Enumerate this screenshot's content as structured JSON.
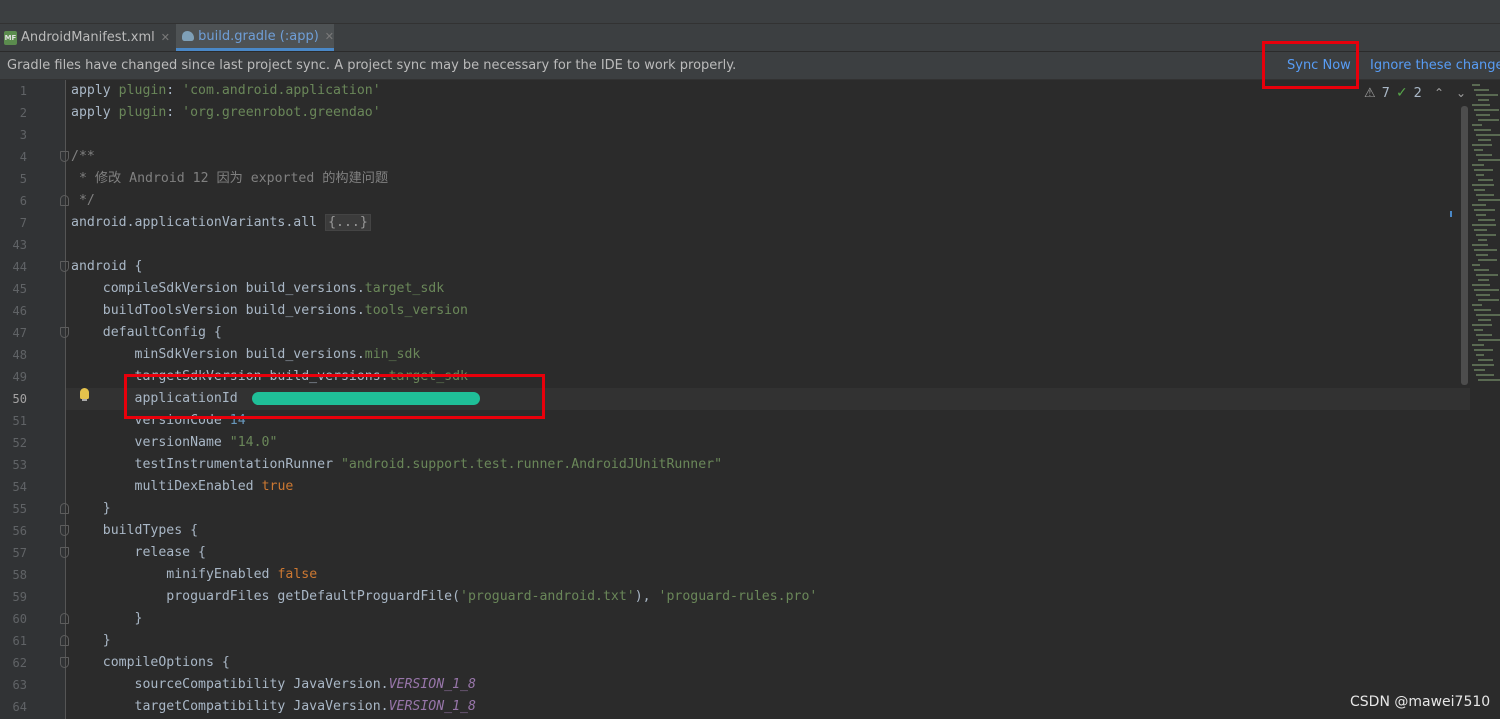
{
  "tabs": [
    {
      "label": "AndroidManifest.xml",
      "icon": "xml-file-icon",
      "active": false
    },
    {
      "label": "build.gradle (:app)",
      "icon": "gradle-file-icon",
      "active": true
    }
  ],
  "notification": {
    "message": "Gradle files have changed since last project sync. A project sync may be necessary for the IDE to work properly.",
    "sync_label": "Sync Now",
    "ignore_label": "Ignore these changes"
  },
  "inspections": {
    "warnings": "7",
    "ok": "2"
  },
  "editor": {
    "current_line": "50",
    "lines": [
      {
        "num": "1",
        "tokens": [
          [
            "plain",
            "apply "
          ],
          [
            "prop",
            "plugin"
          ],
          [
            "plain",
            ": "
          ],
          [
            "str",
            "'com.android.application'"
          ]
        ]
      },
      {
        "num": "2",
        "tokens": [
          [
            "plain",
            "apply "
          ],
          [
            "prop",
            "plugin"
          ],
          [
            "plain",
            ": "
          ],
          [
            "str",
            "'org.greenrobot.greendao'"
          ]
        ]
      },
      {
        "num": "3",
        "tokens": []
      },
      {
        "num": "4",
        "tokens": [
          [
            "comment",
            "/**"
          ]
        ]
      },
      {
        "num": "5",
        "tokens": [
          [
            "comment",
            " * 修改 Android 12 因为 exported 的构建问题"
          ]
        ]
      },
      {
        "num": "6",
        "tokens": [
          [
            "comment",
            " */"
          ]
        ]
      },
      {
        "num": "7",
        "tokens": [
          [
            "plain",
            "android.applicationVariants.all "
          ],
          [
            "folded",
            "{...}"
          ]
        ]
      },
      {
        "num": "43",
        "tokens": []
      },
      {
        "num": "44",
        "tokens": [
          [
            "plain",
            "android {"
          ]
        ]
      },
      {
        "num": "45",
        "tokens": [
          [
            "plain",
            "    compileSdkVersion build_versions."
          ],
          [
            "prop",
            "target_sdk"
          ]
        ]
      },
      {
        "num": "46",
        "tokens": [
          [
            "plain",
            "    buildToolsVersion build_versions."
          ],
          [
            "prop",
            "tools_version"
          ]
        ]
      },
      {
        "num": "47",
        "tokens": [
          [
            "plain",
            "    defaultConfig {"
          ]
        ]
      },
      {
        "num": "48",
        "tokens": [
          [
            "plain",
            "        minSdkVersion build_versions."
          ],
          [
            "prop",
            "min_sdk"
          ]
        ]
      },
      {
        "num": "49",
        "tokens": [
          [
            "plain",
            "        targetSdkVersion build_versions."
          ],
          [
            "prop",
            "target_sdk"
          ]
        ]
      },
      {
        "num": "50",
        "tokens": [
          [
            "plain",
            "        applicationId "
          ],
          [
            "redacted",
            ""
          ]
        ]
      },
      {
        "num": "51",
        "tokens": [
          [
            "plain",
            "        versionCode "
          ],
          [
            "num",
            "14"
          ]
        ]
      },
      {
        "num": "52",
        "tokens": [
          [
            "plain",
            "        versionName "
          ],
          [
            "str",
            "\"14.0\""
          ]
        ]
      },
      {
        "num": "53",
        "tokens": [
          [
            "plain",
            "        testInstrumentationRunner "
          ],
          [
            "str",
            "\"android.support.test.runner.AndroidJUnitRunner\""
          ]
        ]
      },
      {
        "num": "54",
        "tokens": [
          [
            "plain",
            "        multiDexEnabled "
          ],
          [
            "kw",
            "true"
          ]
        ]
      },
      {
        "num": "55",
        "tokens": [
          [
            "plain",
            "    }"
          ]
        ]
      },
      {
        "num": "56",
        "tokens": [
          [
            "plain",
            "    buildTypes {"
          ]
        ]
      },
      {
        "num": "57",
        "tokens": [
          [
            "plain",
            "        release {"
          ]
        ]
      },
      {
        "num": "58",
        "tokens": [
          [
            "plain",
            "            minifyEnabled "
          ],
          [
            "kw",
            "false"
          ]
        ]
      },
      {
        "num": "59",
        "tokens": [
          [
            "plain",
            "            proguardFiles getDefaultProguardFile("
          ],
          [
            "str",
            "'proguard-android.txt'"
          ],
          [
            "plain",
            "), "
          ],
          [
            "str",
            "'proguard-rules.pro'"
          ]
        ]
      },
      {
        "num": "60",
        "tokens": [
          [
            "plain",
            "        }"
          ]
        ]
      },
      {
        "num": "61",
        "tokens": [
          [
            "plain",
            "    }"
          ]
        ]
      },
      {
        "num": "62",
        "tokens": [
          [
            "plain",
            "    compileOptions {"
          ]
        ]
      },
      {
        "num": "63",
        "tokens": [
          [
            "plain",
            "        sourceCompatibility JavaVersion."
          ],
          [
            "ital",
            "VERSION_1_8"
          ]
        ]
      },
      {
        "num": "64",
        "tokens": [
          [
            "plain",
            "        targetCompatibility JavaVersion."
          ],
          [
            "ital",
            "VERSION_1_8"
          ]
        ]
      }
    ]
  },
  "watermark": "CSDN @mawei7510"
}
